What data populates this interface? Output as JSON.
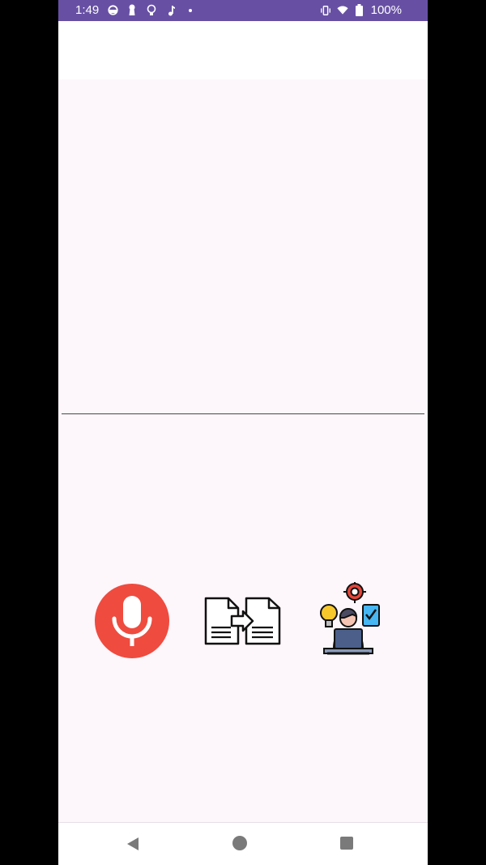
{
  "status_bar": {
    "time": "1:49",
    "battery": "100%",
    "background": "#6750a4",
    "icons": [
      "circle-status-icon",
      "keyhole-icon",
      "lightbulb-icon",
      "music-note-icon",
      "dot-icon",
      "vibrate-icon",
      "wifi-icon",
      "battery-icon"
    ]
  },
  "actions": [
    {
      "name": "microphone",
      "icon": "microphone-icon",
      "color": "#ef4b3f"
    },
    {
      "name": "convert-document",
      "icon": "document-convert-icon"
    },
    {
      "name": "developer",
      "icon": "developer-laptop-icon"
    }
  ],
  "nav_bar": {
    "buttons": [
      "back-icon",
      "home-icon",
      "recent-apps-icon"
    ]
  },
  "colors": {
    "content_background": "#fdf6fb",
    "divider": "#4a4a4a"
  }
}
